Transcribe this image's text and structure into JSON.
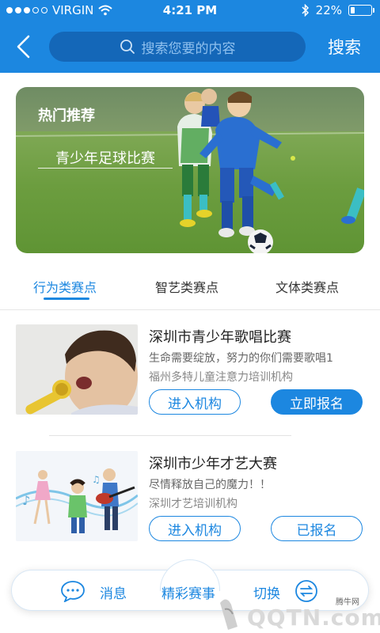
{
  "status_bar": {
    "carrier": "VIRGIN",
    "time": "4:21 PM",
    "battery": "22%",
    "battery_level": 0.22,
    "icons": [
      "signal-dots",
      "wifi-icon",
      "bluetooth-icon",
      "battery-icon"
    ]
  },
  "header": {
    "back_icon": "chevron-left-icon",
    "search_placeholder": "搜索您要的内容",
    "search_button": "搜索"
  },
  "banner": {
    "title": "热门推荐",
    "subtitle": "青少年足球比赛"
  },
  "tabs": [
    {
      "label": "行为类赛点",
      "active": true
    },
    {
      "label": "智艺类赛点",
      "active": false
    },
    {
      "label": "文体类赛点",
      "active": false
    }
  ],
  "cards": [
    {
      "title": "深圳市青少年歌唱比赛",
      "description": "生命需要绽放，努力的你们需要歌唱1",
      "organization": "福州多特儿童注意力培训机构",
      "button_left": "进入机构",
      "button_right": "立即报名"
    },
    {
      "title": "深圳市少年才艺大赛",
      "description": "尽情释放自己的魔力！！",
      "organization": "深圳才艺培训机构",
      "button_left": "进入机构",
      "button_right": "已报名"
    }
  ],
  "bottom_nav": {
    "messages": "消息",
    "center": "精彩赛事",
    "switch": "切换"
  },
  "watermark": {
    "small": "腾牛网",
    "big": "QQTN.com"
  },
  "colors": {
    "primary": "#1c87e0",
    "search_bg": "#1467b8"
  }
}
